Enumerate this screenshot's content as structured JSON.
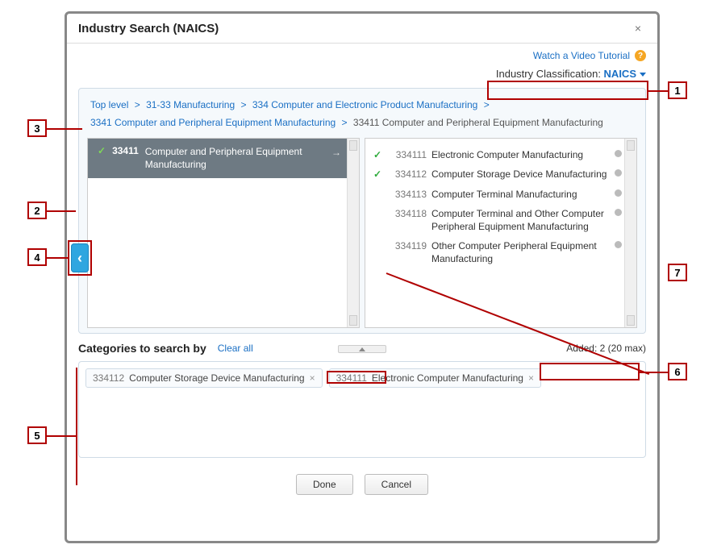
{
  "dialog": {
    "title": "Industry Search (NAICS)",
    "close": "×"
  },
  "topbar": {
    "tutorial": "Watch a Video Tutorial",
    "help": "?"
  },
  "classification": {
    "label": "Industry Classification: ",
    "value": "NAICS"
  },
  "breadcrumb": {
    "items": [
      "Top level",
      "31-33 Manufacturing",
      "334 Computer and Electronic Product Manufacturing",
      "3341 Computer and Peripheral Equipment Manufacturing"
    ],
    "sep": ">",
    "current": "33411 Computer and Peripheral Equipment Manufacturing"
  },
  "left": {
    "code": "33411",
    "label": "Computer and Peripheral Equipment Manufacturing",
    "check": "✓",
    "arrow": "→"
  },
  "right": [
    {
      "checked": true,
      "code": "334111",
      "label": "Electronic Computer Manufacturing"
    },
    {
      "checked": true,
      "code": "334112",
      "label": "Computer Storage Device Manufacturing"
    },
    {
      "checked": false,
      "code": "334113",
      "label": "Computer Terminal Manufacturing"
    },
    {
      "checked": false,
      "code": "334118",
      "label": "Computer Terminal and Other Computer Peripheral Equipment Manufacturing"
    },
    {
      "checked": false,
      "code": "334119",
      "label": "Other Computer Peripheral Equipment Manufacturing"
    }
  ],
  "check_glyph": "✓",
  "categories": {
    "label": "Categories to search by",
    "clear": "Clear all",
    "added": "Added: 2 (20 max)"
  },
  "chips": [
    {
      "code": "334112",
      "label": "Computer Storage Device Manufacturing"
    },
    {
      "code": "334111",
      "label": "Electronic Computer Manufacturing"
    }
  ],
  "chip_remove": "×",
  "footer": {
    "done": "Done",
    "cancel": "Cancel"
  },
  "back": "‹",
  "annotations": [
    "1",
    "2",
    "3",
    "4",
    "5",
    "6",
    "7"
  ]
}
